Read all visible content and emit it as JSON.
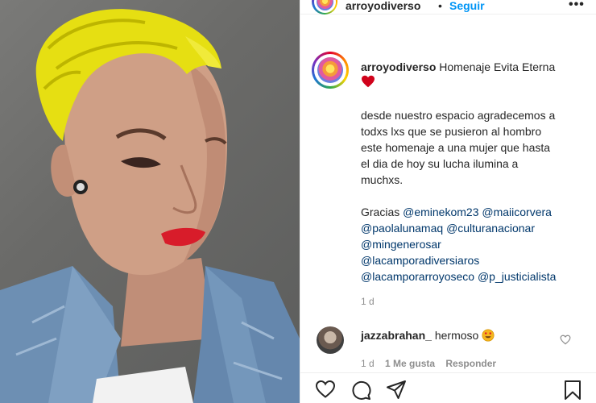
{
  "post": {
    "username": "arroyodiverso",
    "dot": "•",
    "follow_label": "Seguir",
    "more_label": "•••"
  },
  "caption": {
    "username": "arroyodiverso",
    "title": "Homenaje Evita Eterna",
    "heart": "❤️",
    "body_lines": [
      "desde nuestro espacio agradecemos a",
      "todxs lxs que se pusieron al hombro",
      "este homenaje a una mujer que hasta",
      "el dia de hoy su lucha ilumina a",
      "muchxs."
    ],
    "thanks_label": "Gracias",
    "mentions": [
      "@eminekom23",
      "@maiicorvera",
      "@paolalunamaq",
      "@culturanacionar",
      "@mingenerosar",
      "@lacamporadiversiaros",
      "@lacamporarroyoseco",
      "@p_justicialista"
    ],
    "time": "1 d"
  },
  "comment": {
    "username": "jazzabrahan_",
    "text": "hermoso",
    "emoji": "😍",
    "time": "1 d",
    "likes": "1 Me gusta",
    "reply": "Responder"
  },
  "icons": [
    "heart-icon",
    "comment-icon",
    "share-icon",
    "bookmark-icon",
    "more-icon",
    "like-comment-icon"
  ],
  "colors": {
    "link": "#00376b",
    "follow": "#0095f6",
    "text": "#262626",
    "muted": "#8e8e8e",
    "hair": "#e8e000",
    "lips": "#d81c2a"
  }
}
